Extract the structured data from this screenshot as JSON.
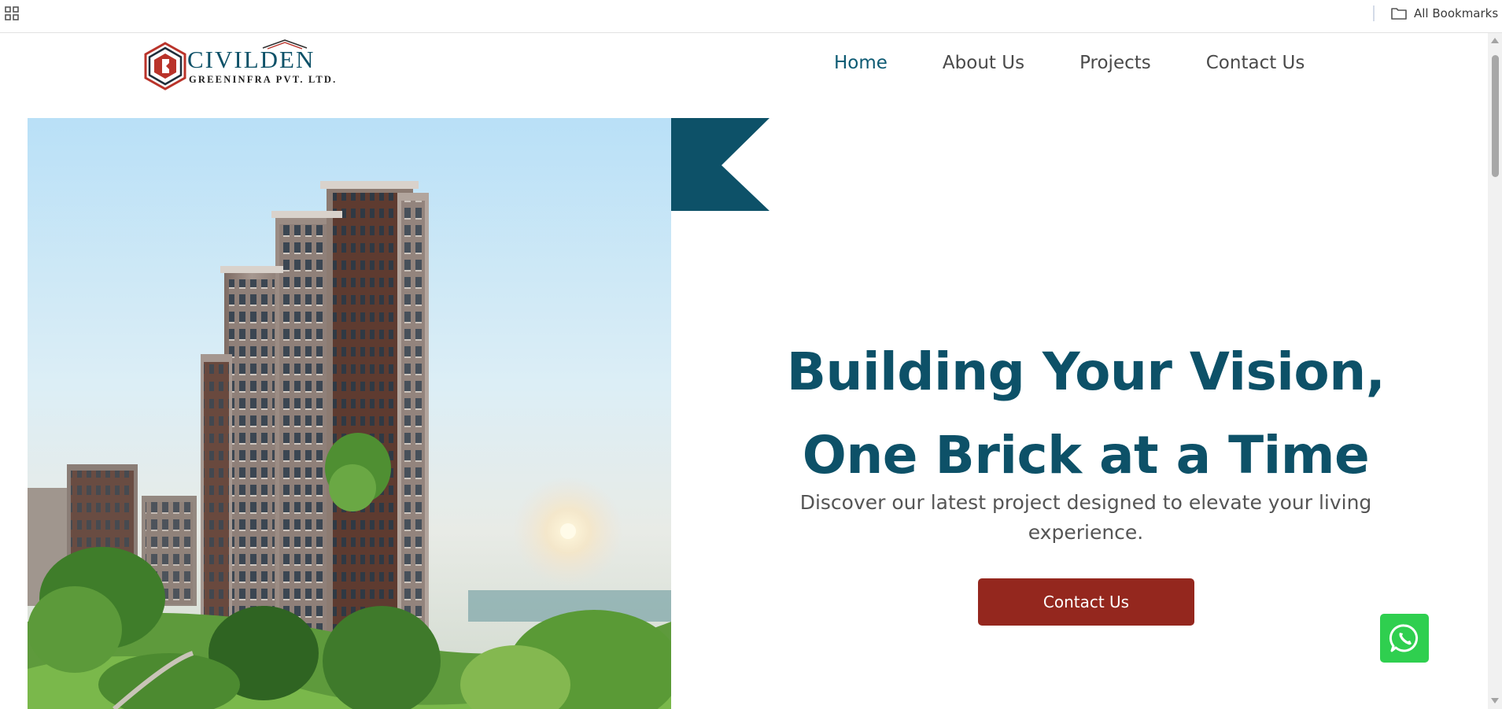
{
  "browser": {
    "all_bookmarks_label": "All Bookmarks"
  },
  "brand": {
    "name": "CIVILDEN",
    "tagline": "GREENINFRA PVT. LTD.",
    "primary_color": "#0d5168",
    "accent_color": "#94271e"
  },
  "nav": {
    "items": [
      {
        "label": "Home",
        "active": true
      },
      {
        "label": "About Us",
        "active": false
      },
      {
        "label": "Projects",
        "active": false
      },
      {
        "label": "Contact Us",
        "active": false
      }
    ]
  },
  "hero": {
    "title_line1": "Building Your Vision,",
    "title_line2": "One Brick at a Time",
    "subtitle": "Discover our latest project designed to elevate your living experience.",
    "cta_label": "Contact Us"
  },
  "icons": {
    "apps": "apps-grid-icon",
    "bookmarks": "folder-icon",
    "whatsapp": "whatsapp-icon"
  }
}
